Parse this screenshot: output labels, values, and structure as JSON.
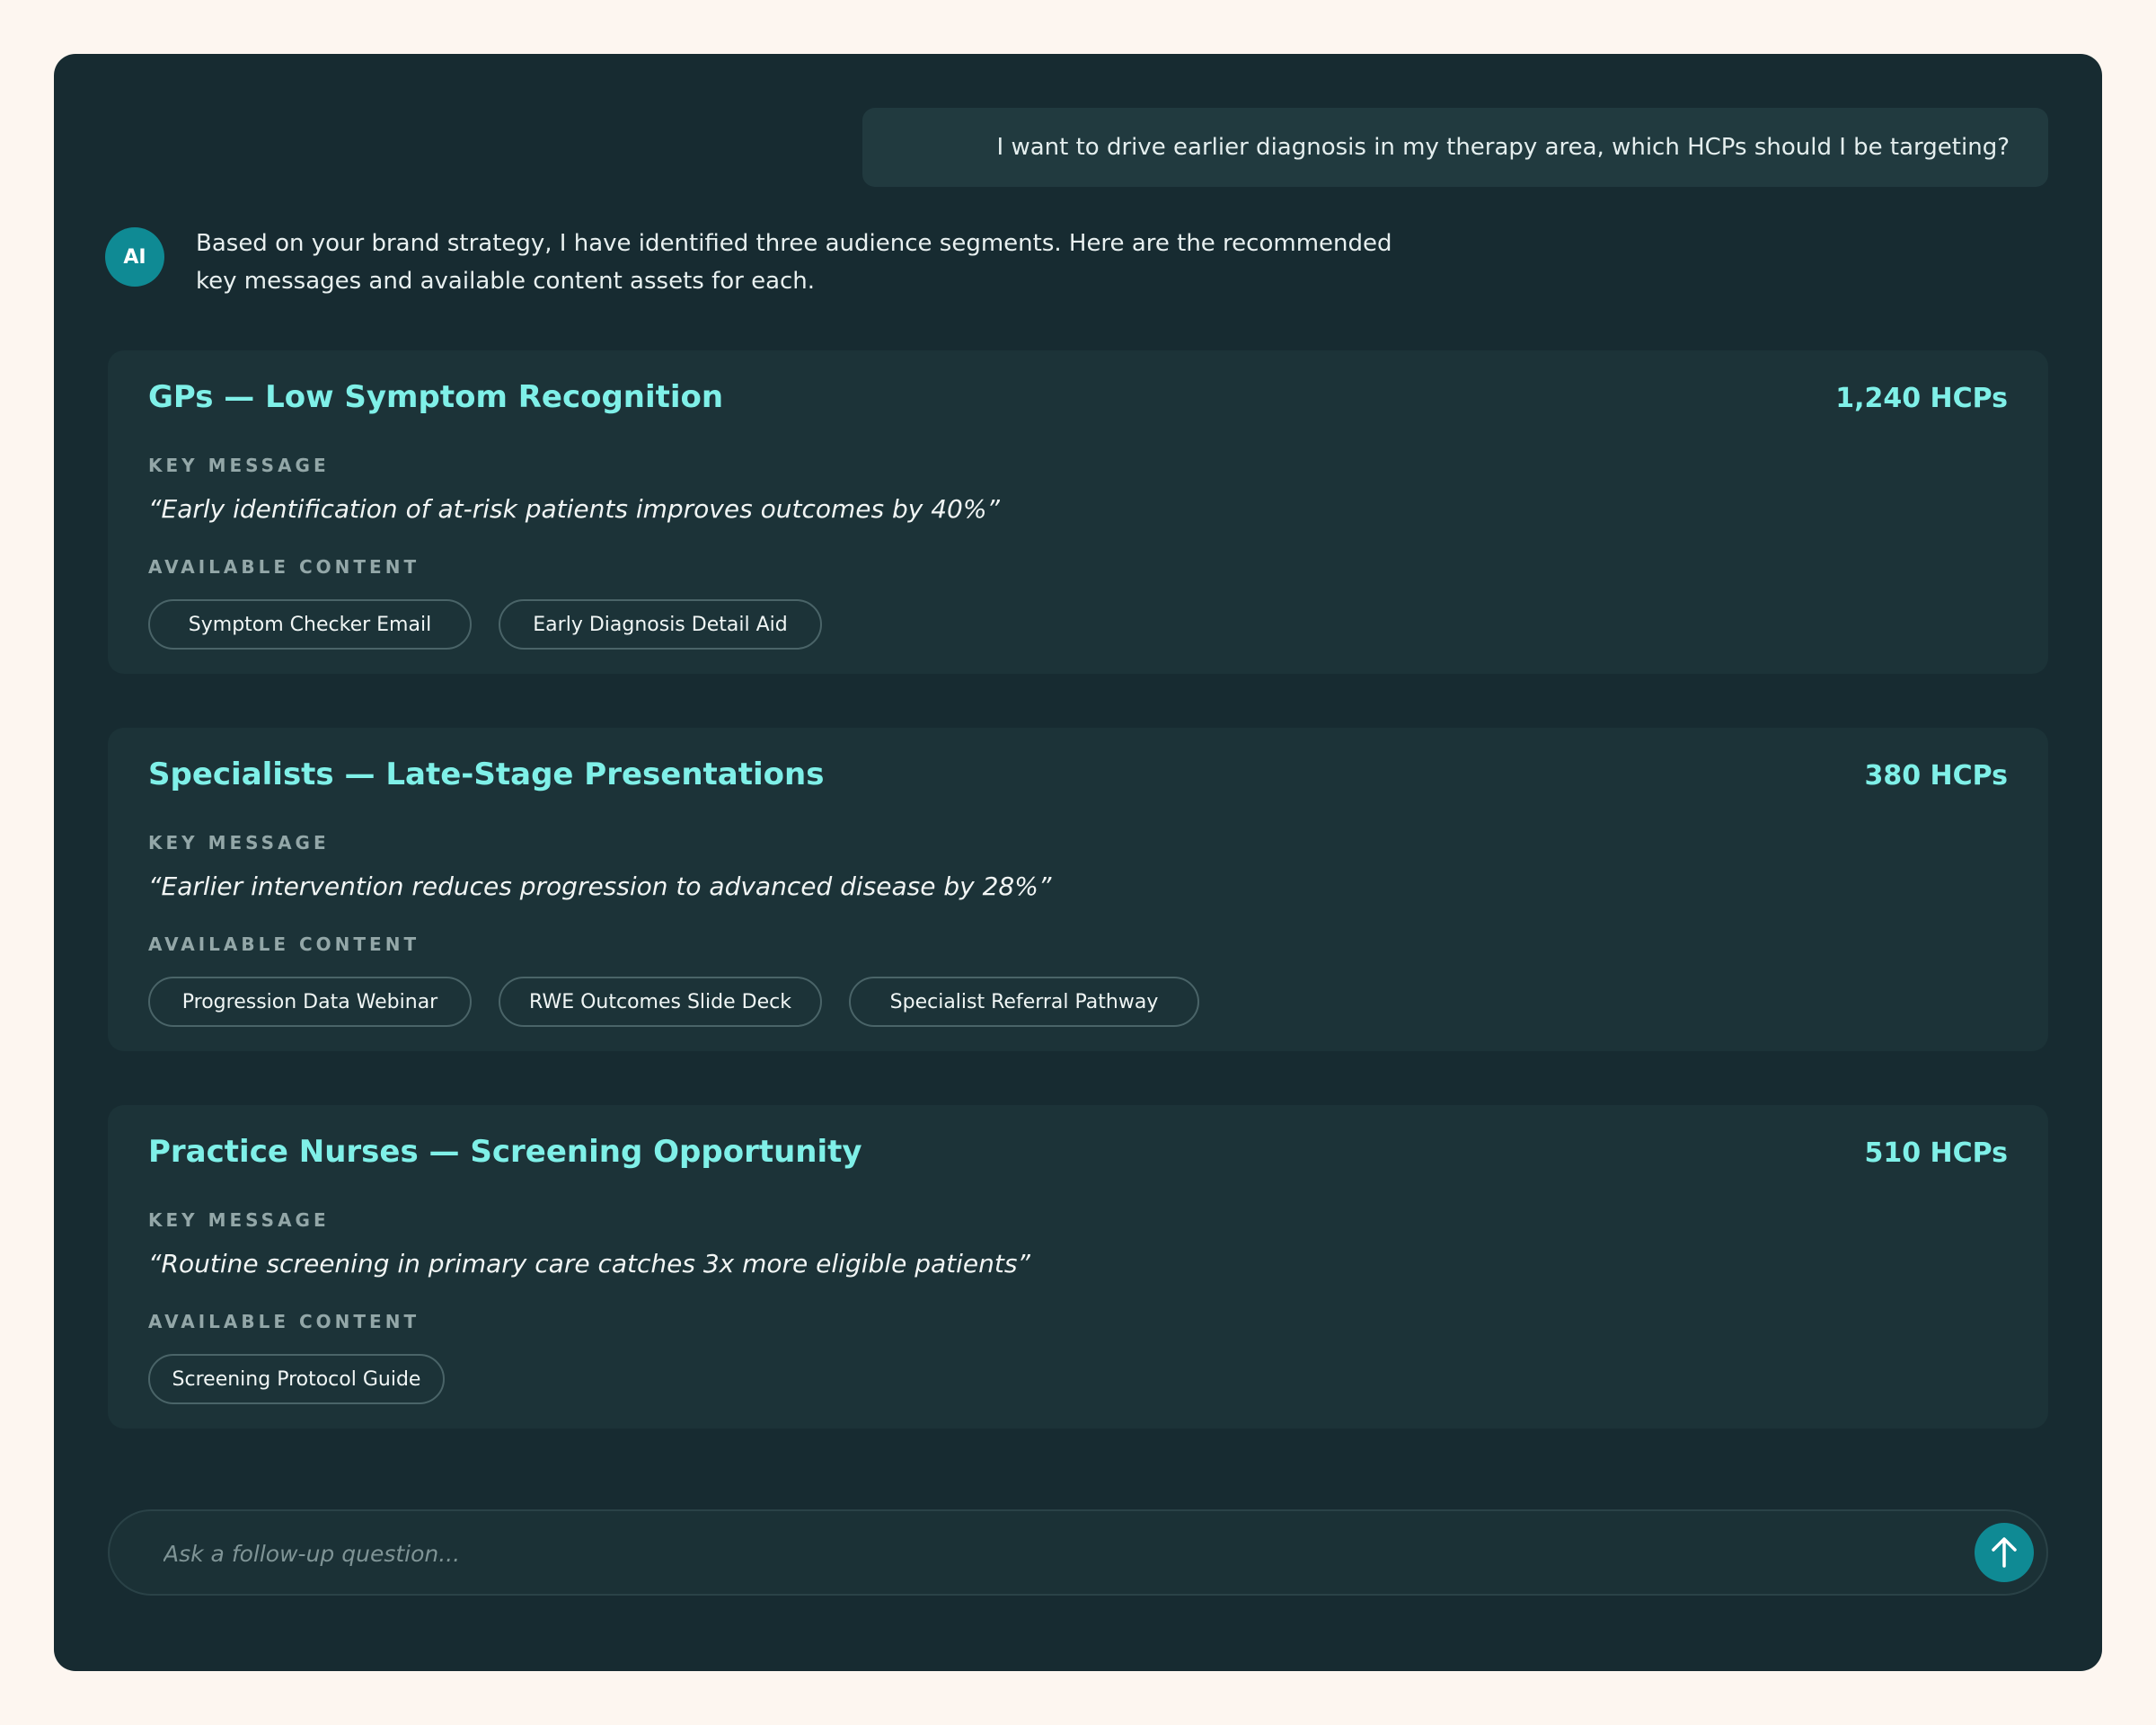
{
  "colors": {
    "page_background": "#fdf6f0",
    "panel_background": "#172b31",
    "card_background": "#1c3338",
    "accent_teal": "#0f8a94",
    "title_cyan": "#7ff0e8"
  },
  "chat": {
    "user_message": "I want to drive earlier diagnosis in my therapy area, which HCPs should I be targeting?",
    "ai_avatar_label": "AI",
    "ai_message": "Based on your brand strategy, I have identified three audience segments. Here are the recommended key messages and available content assets for each."
  },
  "labels": {
    "key_message": "KEY MESSAGE",
    "available_content": "AVAILABLE CONTENT"
  },
  "segments": [
    {
      "title": "GPs — Low Symptom Recognition",
      "count": "1,240 HCPs",
      "key_message": "“Early identification of at-risk patients improves outcomes by 40%”",
      "content": [
        "Symptom Checker Email",
        "Early Diagnosis Detail Aid"
      ]
    },
    {
      "title": "Specialists — Late-Stage Presentations",
      "count": "380 HCPs",
      "key_message": "“Earlier intervention reduces progression to advanced disease by 28%”",
      "content": [
        "Progression Data Webinar",
        "RWE Outcomes Slide Deck",
        "Specialist Referral Pathway"
      ]
    },
    {
      "title": "Practice Nurses — Screening Opportunity",
      "count": "510 HCPs",
      "key_message": "“Routine screening in primary care catches 3x more eligible patients”",
      "content": [
        "Screening Protocol Guide"
      ]
    }
  ],
  "composer": {
    "placeholder": "Ask a follow-up question...",
    "send_icon": "arrow-up-icon"
  }
}
